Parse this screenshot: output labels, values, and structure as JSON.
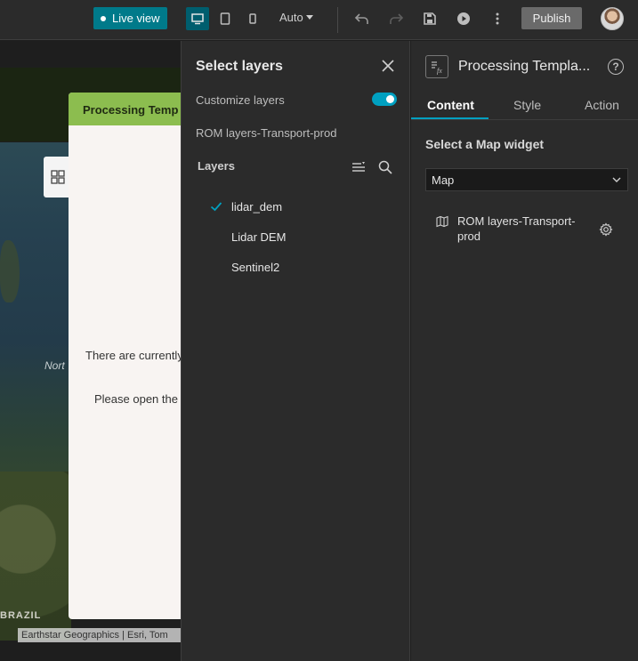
{
  "topbar": {
    "live_view_label": "Live view",
    "screen_size": "Auto",
    "publish_label": "Publish",
    "accent_color": "#007a8a",
    "devices": [
      "desktop-icon",
      "tablet-icon",
      "phone-icon"
    ]
  },
  "canvas": {
    "processing_title": "Processing Temp",
    "message_line1": "There are currently",
    "message_line2": "Please open the",
    "map_label_sea": "Nort",
    "map_label_country": "BRAZIL",
    "attribution": "Earthstar Geographics | Esri, Tom"
  },
  "layers_panel": {
    "title": "Select layers",
    "customize_label": "Customize layers",
    "customize_enabled": true,
    "source_name": "ROM layers-Transport-prod",
    "layers_heading": "Layers",
    "layers": [
      {
        "name": "lidar_dem",
        "selected": true
      },
      {
        "name": "Lidar DEM",
        "selected": false
      },
      {
        "name": "Sentinel2",
        "selected": false
      }
    ]
  },
  "settings": {
    "title": "Processing Templa...",
    "tabs": [
      "Content",
      "Style",
      "Action"
    ],
    "active_tab": "Content",
    "section_title": "Select a Map widget",
    "map_select_value": "Map",
    "map_entry_line1": "ROM layers-Transport-",
    "map_entry_line2": "prod"
  }
}
